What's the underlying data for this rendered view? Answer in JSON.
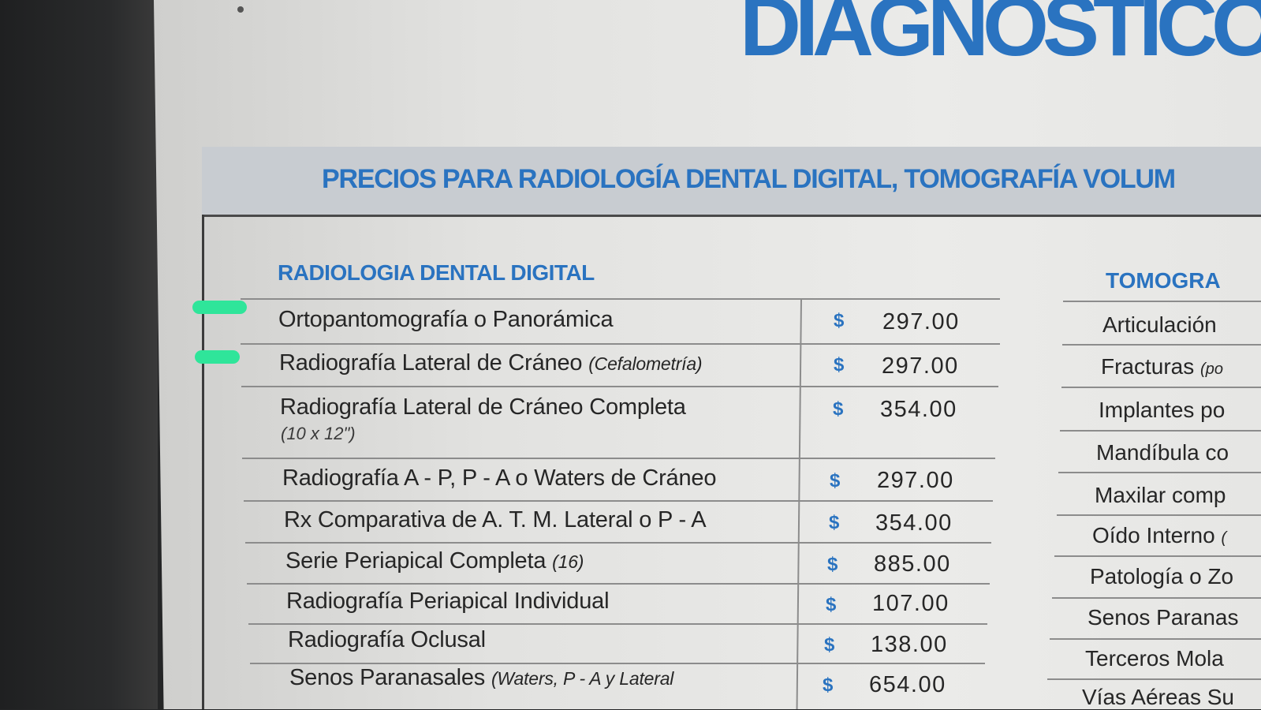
{
  "header": {
    "brand": "DIAGNOSTICO",
    "banner": "PRECIOS PARA RADIOLOGÍA DENTAL DIGITAL, TOMOGRAFÍA VOLUM"
  },
  "left_section": {
    "title": "RADIOLOGIA DENTAL DIGITAL",
    "currency": "$",
    "items": [
      {
        "name": "Ortopantomografía o Panorámica",
        "note": "",
        "sub": "",
        "price": "297.00"
      },
      {
        "name": "Radiografía Lateral de Cráneo",
        "note": "(Cefalometría)",
        "sub": "",
        "price": "297.00"
      },
      {
        "name": "Radiografía Lateral de Cráneo Completa",
        "note": "",
        "sub": "(10 x 12\")",
        "price": "354.00"
      },
      {
        "name": "Radiografía A - P, P - A o Waters de Cráneo",
        "note": "",
        "sub": "",
        "price": "297.00"
      },
      {
        "name": "Rx Comparativa de A. T. M. Lateral o P - A",
        "note": "",
        "sub": "",
        "price": "354.00"
      },
      {
        "name": "Serie Periapical Completa",
        "note": "(16)",
        "sub": "",
        "price": "885.00"
      },
      {
        "name": "Radiografía Periapical Individual",
        "note": "",
        "sub": "",
        "price": "107.00"
      },
      {
        "name": "Radiografía Oclusal",
        "note": "",
        "sub": "",
        "price": "138.00"
      },
      {
        "name": "Senos Paranasales",
        "note": "(Waters, P - A y Lateral",
        "sub": "",
        "price": "654.00"
      }
    ]
  },
  "right_section": {
    "title": "TOMOGRA",
    "items": [
      {
        "name": "Articulación",
        "note": ""
      },
      {
        "name": "Fracturas",
        "note": "(po"
      },
      {
        "name": "Implantes po",
        "note": ""
      },
      {
        "name": "Mandíbula co",
        "note": ""
      },
      {
        "name": "Maxilar comp",
        "note": ""
      },
      {
        "name": "Oído Interno",
        "note": "("
      },
      {
        "name": "Patología o Zo",
        "note": ""
      },
      {
        "name": "Senos Paranas",
        "note": ""
      },
      {
        "name": "Terceros Mola",
        "note": ""
      },
      {
        "name": "Vías Aéreas Su",
        "note": ""
      }
    ]
  },
  "colors": {
    "accent": "#2a73c0",
    "highlight_marker": "#2fe59a"
  }
}
